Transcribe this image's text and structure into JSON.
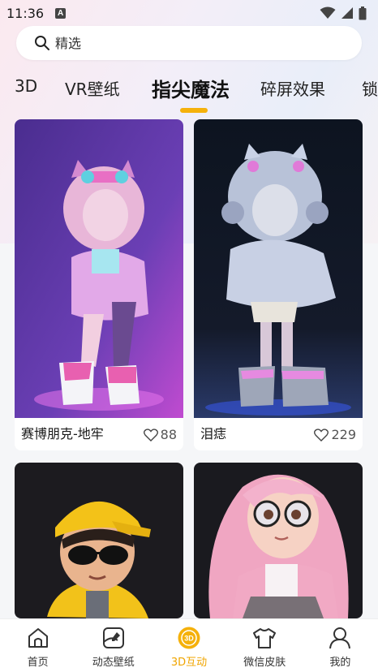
{
  "status_bar": {
    "time": "11:36",
    "notification_letter": "A"
  },
  "search": {
    "placeholder": "精选"
  },
  "tabs": [
    {
      "label": "3D"
    },
    {
      "label": "VR壁纸"
    },
    {
      "label": "指尖魔法",
      "active": true
    },
    {
      "label": "碎屏效果"
    },
    {
      "label": "锁"
    }
  ],
  "cards": [
    {
      "title": "赛博朋克-地牢",
      "likes": "88"
    },
    {
      "title": "泪痣",
      "likes": "229"
    },
    {
      "title": "",
      "likes": ""
    },
    {
      "title": "",
      "likes": ""
    }
  ],
  "bottom_nav": [
    {
      "label": "首页",
      "icon": "home-icon"
    },
    {
      "label": "动态壁纸",
      "icon": "wallpaper-icon"
    },
    {
      "label": "3D互动",
      "icon": "3d-icon",
      "active": true
    },
    {
      "label": "微信皮肤",
      "icon": "shirt-icon"
    },
    {
      "label": "我的",
      "icon": "profile-icon"
    }
  ],
  "colors": {
    "accent": "#f5b10b",
    "nav_active": "#f0a500"
  }
}
